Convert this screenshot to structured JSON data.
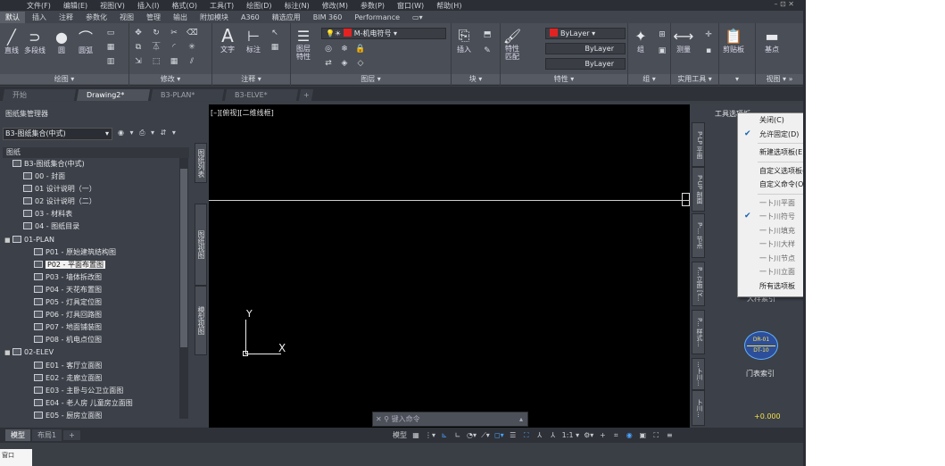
{
  "menubar": {
    "items": [
      "文件(F)",
      "编辑(E)",
      "视图(V)",
      "插入(I)",
      "格式(O)",
      "工具(T)",
      "绘图(D)",
      "标注(N)",
      "修改(M)",
      "参数(P)",
      "窗口(W)",
      "帮助(H)"
    ],
    "window_controls": "– ⊡ ✕"
  },
  "ribbon_tabs": [
    "默认",
    "插入",
    "注释",
    "参数化",
    "视图",
    "管理",
    "输出",
    "附加模块",
    "A360",
    "精选应用",
    "BIM 360",
    "Performance",
    "▭▾"
  ],
  "ribbon": {
    "draw": {
      "title": "绘图 ▾",
      "line": "直线",
      "polyline": "多段线",
      "circle": "圆",
      "arc": "圆弧"
    },
    "modify": {
      "title": "修改 ▾"
    },
    "annotation": {
      "title": "注释 ▾",
      "text": "文字",
      "dimension": "标注"
    },
    "layers": {
      "title": "图层 ▾",
      "layer_properties": "图层\n特性",
      "current_layer": "M-机电符号"
    },
    "block": {
      "title": "块 ▾",
      "insert": "插入"
    },
    "properties": {
      "title": "特性 ▾",
      "match": "特性\n匹配",
      "color": "ByLayer",
      "linetype": "ByLayer",
      "lineweight": "ByLayer"
    },
    "groups": {
      "title": "组 ▾",
      "group": "组"
    },
    "utilities": {
      "title": "实用工具 ▾",
      "measure": "测量"
    },
    "clipboard": {
      "title": "▾",
      "paste": "剪贴板"
    },
    "view": {
      "title": "视图 ▾ »",
      "base": "基点"
    }
  },
  "file_tabs": [
    "开始",
    "Drawing2*",
    "B3-PLAN*",
    "B3-ELVE*",
    "+"
  ],
  "sheet_set_manager": {
    "title": "图纸集管理器",
    "set_selector": "B3-图纸集合(中式)",
    "sheets_header": "图纸",
    "tree": [
      {
        "label": "B3-图纸集合(中式)",
        "level": 0,
        "toggle": "",
        "selected": false
      },
      {
        "label": "00 - 封面",
        "level": 1,
        "toggle": "",
        "selected": false
      },
      {
        "label": "01 设计说明（一）",
        "level": 1,
        "toggle": "",
        "selected": false
      },
      {
        "label": "02 设计说明（二）",
        "level": 1,
        "toggle": "",
        "selected": false
      },
      {
        "label": "03 - 材料表",
        "level": 1,
        "toggle": "",
        "selected": false
      },
      {
        "label": "04 - 图纸目录",
        "level": 1,
        "toggle": "",
        "selected": false
      },
      {
        "label": "01-PLAN",
        "level": 0,
        "toggle": "■",
        "selected": false
      },
      {
        "label": "P01 - 原始建筑结构图",
        "level": 2,
        "toggle": "",
        "selected": false
      },
      {
        "label": "P02 - 平面布置图",
        "level": 2,
        "toggle": "",
        "selected": true
      },
      {
        "label": "P03 - 墙体拆改图",
        "level": 2,
        "toggle": "",
        "selected": false
      },
      {
        "label": "P04 - 天花布置图",
        "level": 2,
        "toggle": "",
        "selected": false
      },
      {
        "label": "P05 - 灯具定位图",
        "level": 2,
        "toggle": "",
        "selected": false
      },
      {
        "label": "P06 - 灯具回路图",
        "level": 2,
        "toggle": "",
        "selected": false
      },
      {
        "label": "P07 - 地面铺装图",
        "level": 2,
        "toggle": "",
        "selected": false
      },
      {
        "label": "P08 - 机电点位图",
        "level": 2,
        "toggle": "",
        "selected": false
      },
      {
        "label": "02-ELEV",
        "level": 0,
        "toggle": "■",
        "selected": false
      },
      {
        "label": "E01 - 客厅立面图",
        "level": 2,
        "toggle": "",
        "selected": false
      },
      {
        "label": "E02 - 走廊立面图",
        "level": 2,
        "toggle": "",
        "selected": false
      },
      {
        "label": "E03 - 主卧与公卫立面图",
        "level": 2,
        "toggle": "",
        "selected": false
      },
      {
        "label": "E04 - 老人房 儿童房立面图",
        "level": 2,
        "toggle": "",
        "selected": false
      },
      {
        "label": "E05 - 厨房立面图",
        "level": 2,
        "toggle": "",
        "selected": false
      }
    ],
    "side_tabs": [
      "图纸列表",
      "图纸视图",
      "模型视图"
    ]
  },
  "canvas": {
    "viewport_label": "[–][俯视][二维线框]",
    "ucs_y": "Y",
    "ucs_x": "X",
    "command_placeholder": "键入命令"
  },
  "tool_palette": {
    "title": "工具选项板",
    "side_tabs": [
      "P-LP 平面",
      "P-UP 剖面",
      "P-... 节点",
      "P...立面 [Y...",
      "P... 样式...",
      "...卜川...",
      "卜川..."
    ],
    "door_tag_top": "DR-01",
    "door_tag_bottom": "DT-10",
    "door_index_label": "门表索引",
    "hidden_label": "大样索引",
    "elevation_label": "+0.000"
  },
  "context_menu": {
    "items": [
      {
        "label": "关闭(C)",
        "checked": false,
        "submenu": false,
        "dim": false
      },
      {
        "label": "允许固定(D)",
        "checked": true,
        "submenu": false,
        "dim": false
      },
      {
        "sep": true
      },
      {
        "label": "新建选项板(E)",
        "checked": false,
        "submenu": false,
        "dim": false
      },
      {
        "sep": true
      },
      {
        "label": "自定义选项板(Z)...",
        "checked": false,
        "submenu": false,
        "dim": false
      },
      {
        "label": "自定义命令(O)...",
        "checked": false,
        "submenu": false,
        "dim": false
      },
      {
        "sep": true
      },
      {
        "label": "一卜川平面",
        "checked": false,
        "submenu": true,
        "dim": true
      },
      {
        "label": "一卜川符号",
        "checked": true,
        "submenu": false,
        "dim": true
      },
      {
        "label": "一卜川填充",
        "checked": false,
        "submenu": false,
        "dim": true
      },
      {
        "label": "一卜川大样",
        "checked": false,
        "submenu": false,
        "dim": true
      },
      {
        "label": "一卜川节点",
        "checked": false,
        "submenu": false,
        "dim": true
      },
      {
        "label": "一卜川立面",
        "checked": false,
        "submenu": true,
        "dim": true
      },
      {
        "label": "所有选项板",
        "checked": false,
        "submenu": false,
        "dim": false
      }
    ]
  },
  "layout_tabs": [
    "模型",
    "布局1",
    "+"
  ],
  "status_bar": {
    "model_label": "模型",
    "scale": "1:1 ▾"
  },
  "corner_text": "窗口"
}
